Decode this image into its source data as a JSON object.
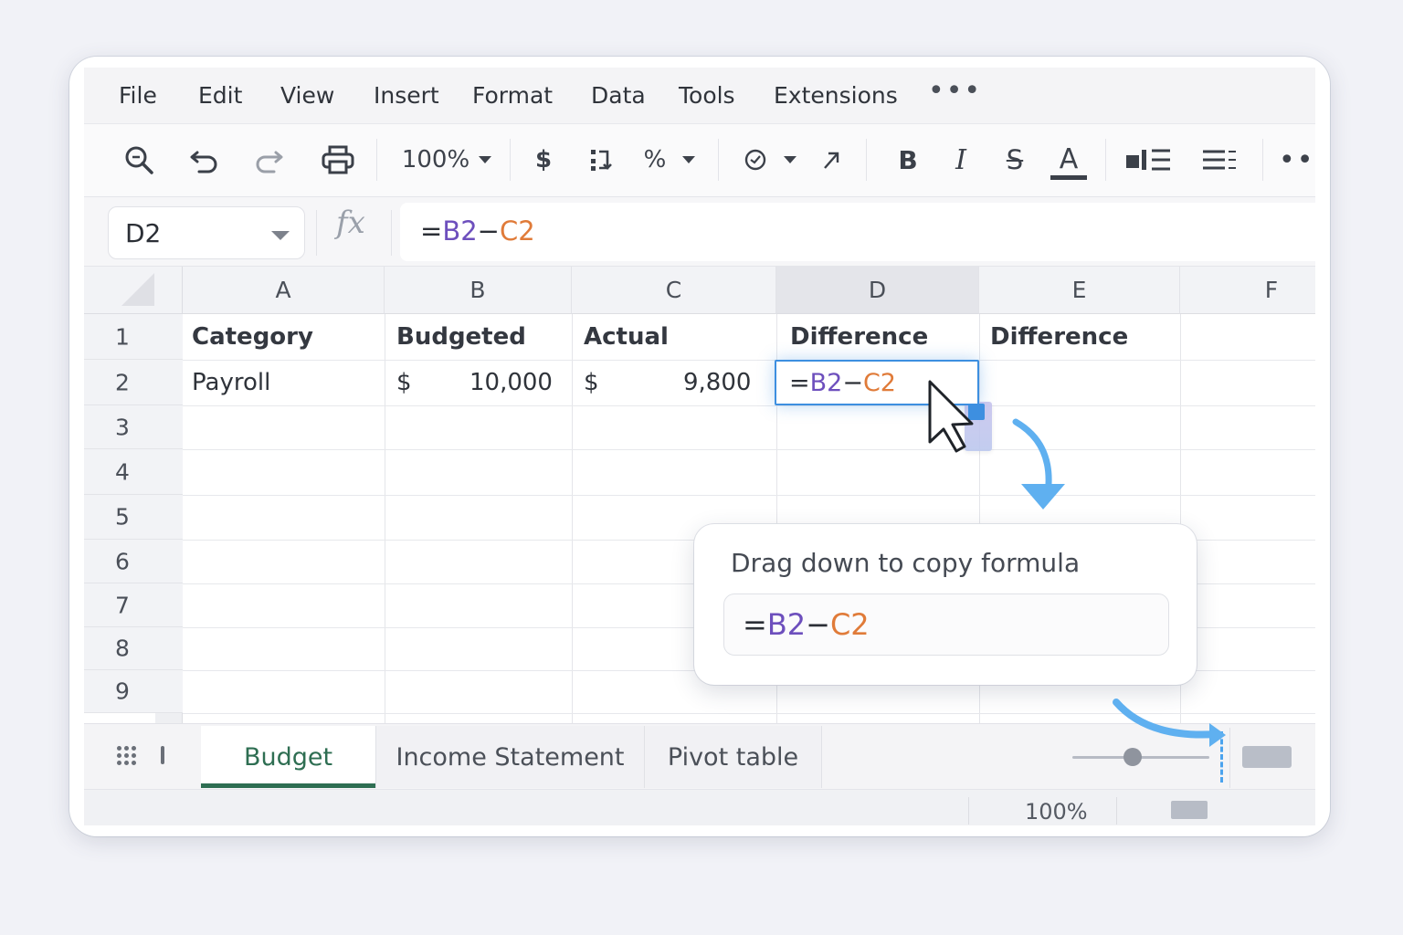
{
  "menu": [
    "File",
    "Edit",
    "View",
    "Insert",
    "Format",
    "Data",
    "Tools",
    "Extensions"
  ],
  "menu_more": "•••",
  "toolbar": {
    "zoom": "100%",
    "currency": "$",
    "percent": "%",
    "bold": "B",
    "italic": "I",
    "strike": "S",
    "text_color": "A",
    "more": "•••"
  },
  "formula_bar": {
    "name_box": "D2",
    "fx": "fx",
    "formula_eq": "=",
    "formula_b": "B2",
    "formula_op": "−",
    "formula_c": "C2"
  },
  "columns": [
    "A",
    "B",
    "C",
    "D",
    "E",
    "F"
  ],
  "rows": [
    "1",
    "2",
    "3",
    "4",
    "5",
    "6",
    "7",
    "8",
    "9"
  ],
  "cells": {
    "a1": "Category",
    "b1": "Budgeted",
    "c1": "Actual",
    "d1": "Difference",
    "e1": "Difference",
    "a2": "Payroll",
    "b2_symbol": "$",
    "b2_value": "10,000",
    "c2_symbol": "$",
    "c2_value": "9,800"
  },
  "active_cell": {
    "eq": "=",
    "b": "B2",
    "op": "−",
    "c": "C2"
  },
  "tooltip": {
    "title": "Drag down to copy formula",
    "eq": "=",
    "b": "B2",
    "op": "−",
    "c": "C2"
  },
  "sheets": [
    "Budget",
    "Income Statement",
    "Pivot table"
  ],
  "status": {
    "zoom": "100%"
  },
  "colors": {
    "ref_b": "#6d4fbd",
    "ref_c": "#e07b39",
    "selection": "#3d8fe0",
    "active_tab": "#2e6e52",
    "arrow": "#5fb0f0"
  }
}
